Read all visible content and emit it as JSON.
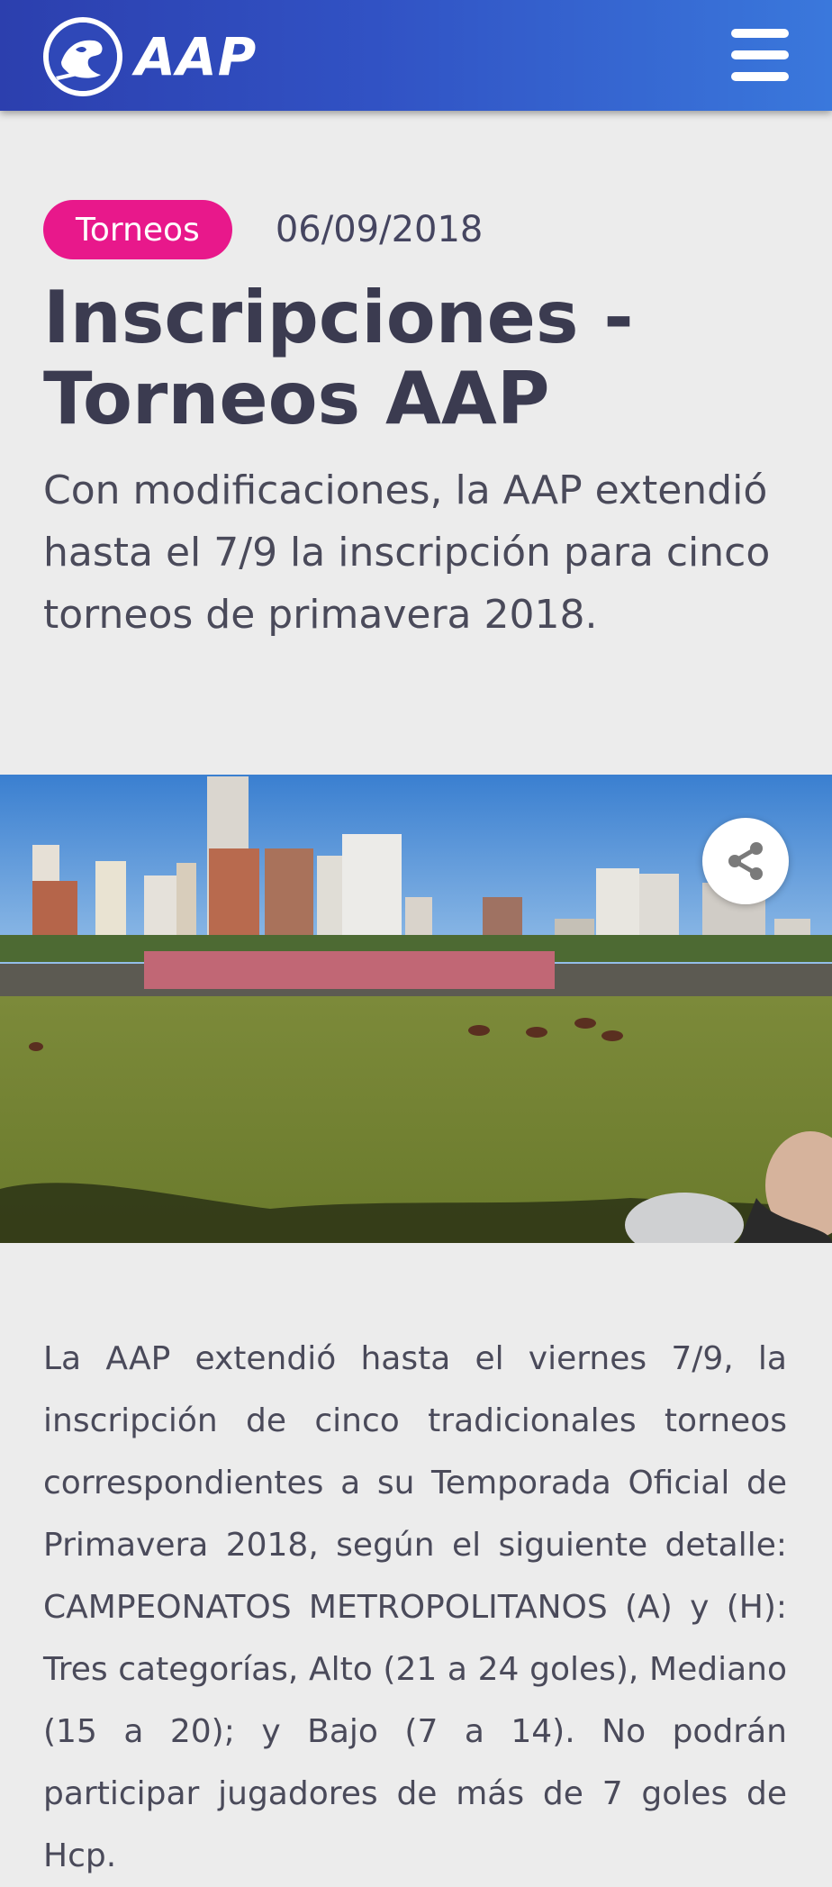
{
  "header": {
    "logo_text": "AAP",
    "logo_icon": "aap-polo-logo-icon",
    "menu_icon": "hamburger-menu-icon",
    "colors": {
      "gradient_start": "#2c3fae",
      "gradient_end": "#3a78dc"
    }
  },
  "article": {
    "category": "Torneos",
    "category_color": "#e8188b",
    "date": "06/09/2018",
    "title": "Inscripciones - Torneos AAP",
    "subtitle": "Con modificaciones, la AAP extendió hasta el 7/9 la inscripción para cinco torneos de primavera 2018.",
    "share_icon": "share-icon",
    "body": "La AAP extendió hasta el viernes 7/9, la inscripción de cinco tradicionales torneos correspondientes a su Temporada Oficial de Primavera 2018, según el siguiente detalle: CAMPEONATOS METROPOLITANOS (A) y (H): Tres categorías, Alto (21 a 24 goles), Mediano (15 a 20); y Bajo (7 a 14). No podrán participar jugadores de más de 7 goles de Hcp."
  }
}
